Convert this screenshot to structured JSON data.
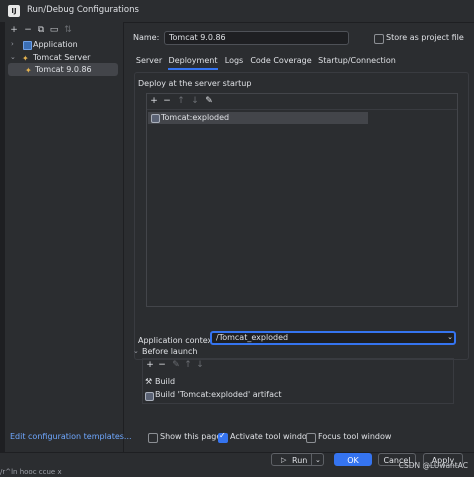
{
  "window": {
    "title": "Run/Debug Configurations",
    "logo": "IJ"
  },
  "sidebar": {
    "toolbar_icons": [
      "add-icon",
      "remove-icon",
      "copy-icon",
      "folder-icon",
      "sort-icon"
    ],
    "items": [
      {
        "label": "Application",
        "icon": "application-icon",
        "expanded": false
      },
      {
        "label": "Tomcat Server",
        "icon": "tomcat-icon",
        "expanded": true
      },
      {
        "label": "Tomcat 9.0.86",
        "icon": "tomcat-icon",
        "selected": true
      }
    ],
    "link": "Edit configuration templates..."
  },
  "form": {
    "name_label": "Name:",
    "name_value": "Tomcat 9.0.86",
    "store_label": "Store as project file",
    "store_checked": false
  },
  "tabs": [
    {
      "label": "Server",
      "active": false
    },
    {
      "label": "Deployment",
      "active": true
    },
    {
      "label": "Logs",
      "active": false
    },
    {
      "label": "Code Coverage",
      "active": false
    },
    {
      "label": "Startup/Connection",
      "active": false
    }
  ],
  "deployment": {
    "heading": "Deploy at the server startup",
    "toolbar": [
      "+",
      "−",
      "↑",
      "↓",
      "✎"
    ],
    "items": [
      "Tomcat:exploded"
    ],
    "context_label": "Application context:",
    "context_value": "/Tomcat_exploded"
  },
  "before_launch": {
    "heading": "Before launch",
    "toolbar": [
      "+",
      "−",
      "✎",
      "↑",
      "↓"
    ],
    "items": [
      {
        "label": "Build",
        "icon": "build-icon"
      },
      {
        "label": "Build 'Tomcat:exploded' artifact",
        "icon": "artifact-icon"
      }
    ]
  },
  "options": {
    "show_page": {
      "label": "Show this page",
      "checked": false
    },
    "activate_tool": {
      "label": "Activate tool window",
      "checked": true
    },
    "focus_tool": {
      "label": "Focus tool window",
      "checked": false
    }
  },
  "buttons": {
    "run": "Run",
    "ok": "OK",
    "cancel": "Cancel",
    "apply": "Apply"
  },
  "watermark": "CSDN @LUwantAC",
  "bottom_text": "/r^ln  hooc   ccue  x"
}
